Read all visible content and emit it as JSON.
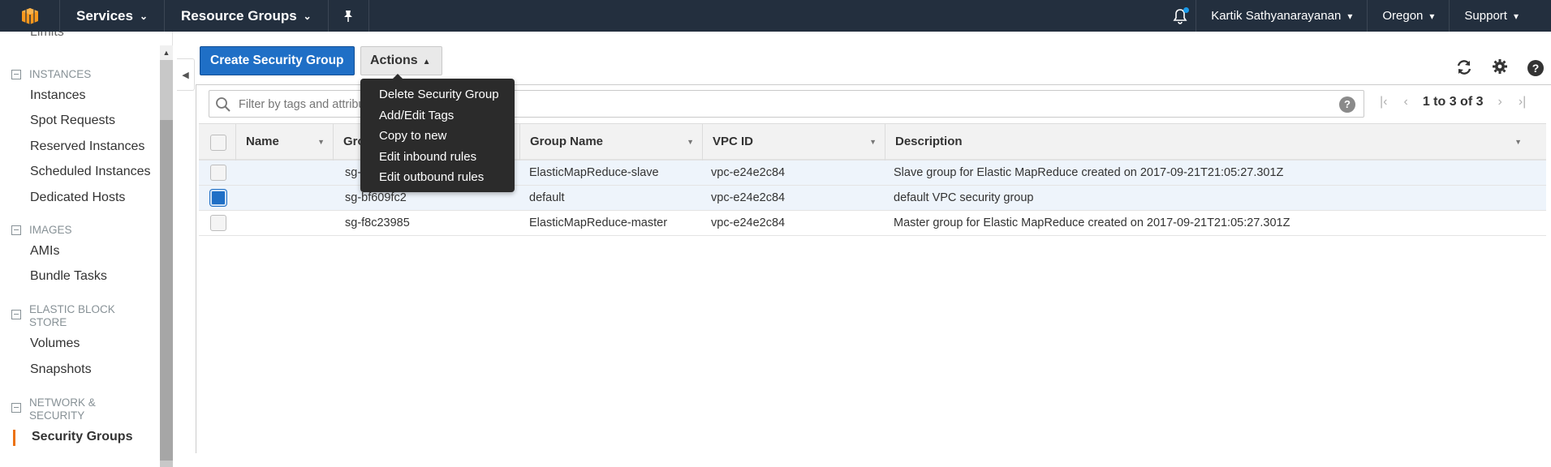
{
  "topnav": {
    "services": "Services",
    "resource_groups": "Resource Groups",
    "user": "Kartik Sathyanarayanan",
    "region": "Oregon",
    "support": "Support"
  },
  "sidebar": {
    "partial_top": "Limits",
    "sections": [
      {
        "title": "INSTANCES",
        "items": [
          "Instances",
          "Spot Requests",
          "Reserved Instances",
          "Scheduled Instances",
          "Dedicated Hosts"
        ]
      },
      {
        "title": "IMAGES",
        "items": [
          "AMIs",
          "Bundle Tasks"
        ]
      },
      {
        "title": "ELASTIC BLOCK STORE",
        "items": [
          "Volumes",
          "Snapshots"
        ]
      },
      {
        "title": "NETWORK & SECURITY",
        "items": [
          "Security Groups"
        ]
      }
    ]
  },
  "toolbar": {
    "create_label": "Create Security Group",
    "actions_label": "Actions"
  },
  "actions_menu": [
    "Delete Security Group",
    "Add/Edit Tags",
    "Copy to new",
    "Edit inbound rules",
    "Edit outbound rules"
  ],
  "filter": {
    "placeholder": "Filter by tags and attributes or search by keyword"
  },
  "pager": {
    "text": "1 to 3 of 3"
  },
  "table": {
    "columns": [
      "Name",
      "Group ID",
      "Group Name",
      "VPC ID",
      "Description"
    ],
    "rows": [
      {
        "name": "",
        "group_id": "sg-b0908fcd",
        "group_name": "ElasticMapReduce-slave",
        "vpc": "vpc-e24e2c84",
        "desc": "Slave group for Elastic MapReduce created on 2017-09-21T21:05:27.301Z",
        "checked": false
      },
      {
        "name": "",
        "group_id": "sg-bf609fc2",
        "group_name": "default",
        "vpc": "vpc-e24e2c84",
        "desc": "default VPC security group",
        "checked": true
      },
      {
        "name": "",
        "group_id": "sg-f8c23985",
        "group_name": "ElasticMapReduce-master",
        "vpc": "vpc-e24e2c84",
        "desc": "Master group for Elastic MapReduce created on 2017-09-21T21:05:27.301Z",
        "checked": false
      }
    ]
  },
  "colors": {
    "accent": "#1f6fc6",
    "nav_bg": "#232f3e",
    "active": "#ec7211"
  }
}
